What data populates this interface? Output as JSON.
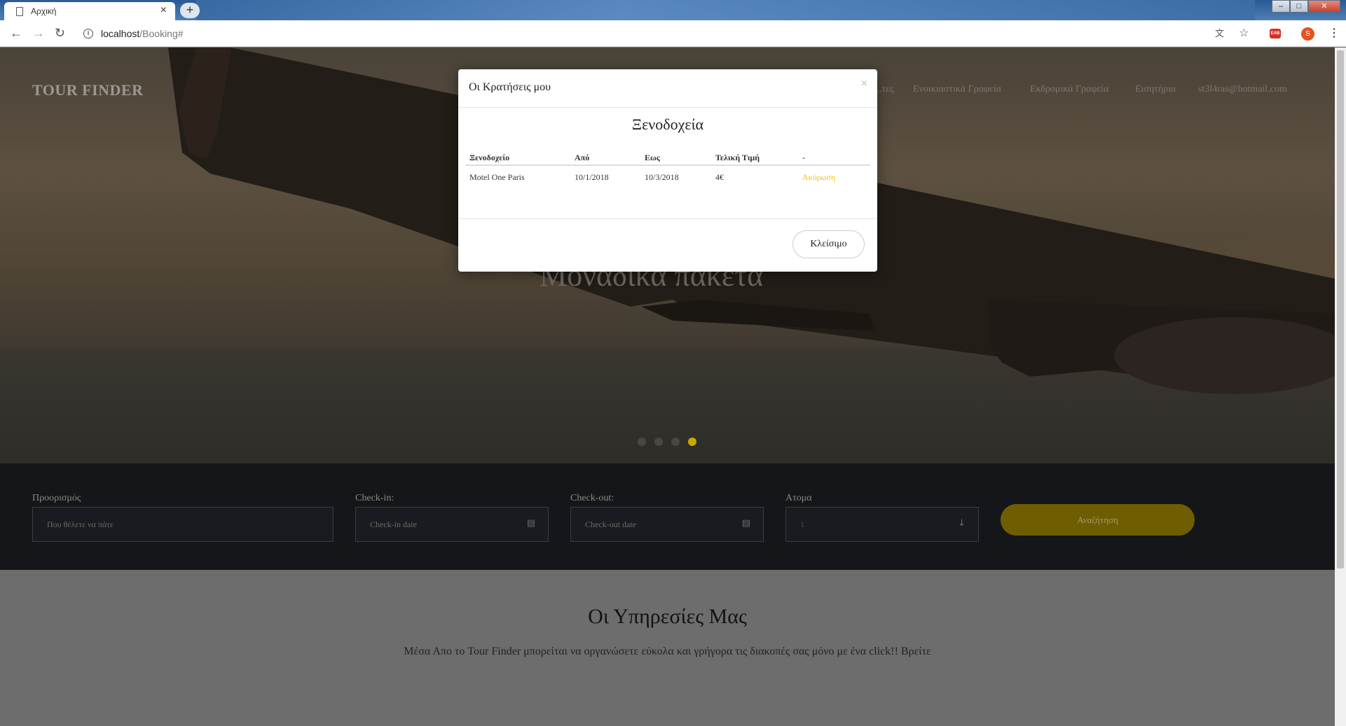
{
  "browser": {
    "tab_title": "Αρχική",
    "tab_close": "×",
    "new_tab": "+",
    "url_host": "localhost",
    "url_path": "/Booking#",
    "ext_badge": "EAB",
    "profile_initial": "S",
    "win_min": "–",
    "win_max": "□",
    "win_close": "✕"
  },
  "site": {
    "brand": "TOUR FINDER",
    "nav": [
      "...τες",
      "Ενοικιαστικά Γραφεία",
      "Εκδρομικά Γραφεία",
      "Εισητήρια",
      "st3l4ras@hotmail.com"
    ],
    "hero_caption": "Μοναδικά πακέτα",
    "slider_active_index": 3
  },
  "search": {
    "destination_label": "Προορισμός",
    "destination_placeholder": "Που θέλετε να πάτε",
    "checkin_label": "Check-in:",
    "checkin_placeholder": "Check-in date",
    "checkout_label": "Check-out:",
    "checkout_placeholder": "Check-out date",
    "people_label": "Ατομα",
    "people_value": "1",
    "button": "Αναζήτηση"
  },
  "services": {
    "title": "Οι Υπηρεσίες Μας",
    "text": "Μέσα Απο το Tour Finder μπορείται να οργανώσετε εύκολα και γρήγορα τις διακοπές σας μόνο με ένα click!! Βρείτε"
  },
  "modal": {
    "title": "Οι Κρατήσεις μου",
    "close_x": "×",
    "section_title": "Ξενοδοχεία",
    "columns": [
      "Ξενοδοχείο",
      "Από",
      "Εως",
      "Τελική Τιμή",
      "-"
    ],
    "rows": [
      [
        "Motel One Paris",
        "10/1/2018",
        "10/3/2018",
        "4€",
        "Ακύρωση"
      ]
    ],
    "close_button": "Κλείσιμο"
  },
  "colors": {
    "accent": "#f2c200",
    "search_button": "#6f5d02",
    "search_bar_bg": "#14161a"
  }
}
